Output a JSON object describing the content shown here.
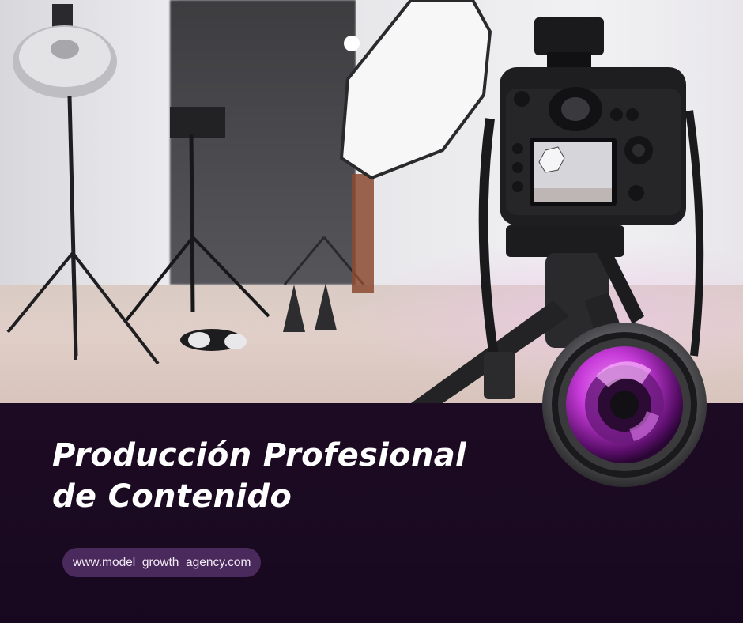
{
  "headline": {
    "line1": "Producción Profesional",
    "line2": "de Contenido"
  },
  "website": {
    "url": "www.model_growth_agency.com"
  },
  "colors": {
    "panel_background": "#1a0a1f",
    "headline_text": "#ffffff",
    "url_pill": "#4a2a5c",
    "lens_accent": "#c63ad8"
  },
  "icons": [
    "camera-lens-icon"
  ]
}
